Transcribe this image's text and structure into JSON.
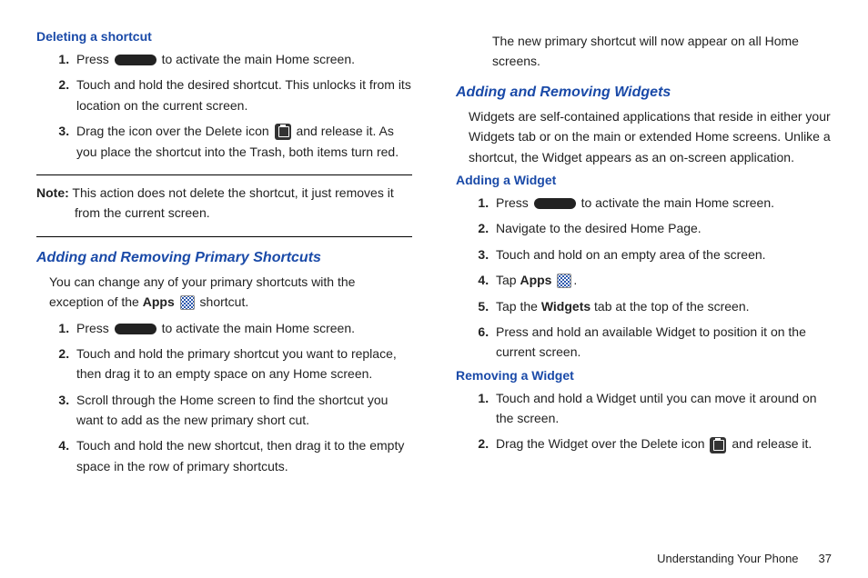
{
  "left": {
    "h1": "Deleting a shortcut",
    "steps1": {
      "s1a": "Press ",
      "s1b": " to activate the main Home screen.",
      "s2": "Touch and hold the desired shortcut. This unlocks it from its location on the current screen.",
      "s3a": "Drag the icon over the Delete icon ",
      "s3b": " and release it. As you place the shortcut into the Trash, both items turn red."
    },
    "noteLabel": "Note:",
    "noteText": " This action does not delete the shortcut, it just removes it from the current screen.",
    "h2": "Adding and Removing Primary Shortcuts",
    "introA": "You can change any of your primary shortcuts with the exception of the ",
    "introAppsWord": "Apps",
    "introB": " shortcut.",
    "steps2": {
      "s1a": "Press ",
      "s1b": " to activate the main Home screen.",
      "s2": "Touch and hold the primary shortcut you want to replace, then drag it to an empty space on any Home screen.",
      "s3": "Scroll through the Home screen to find the shortcut you want to add as the new primary short cut.",
      "s4": "Touch and hold the new shortcut, then drag it to the empty space in the row of primary shortcuts."
    }
  },
  "right": {
    "cont": "The new primary shortcut will now appear on all Home screens.",
    "h1": "Adding and Removing Widgets",
    "intro": "Widgets are self-contained applications that reside in either your Widgets tab or on the main or extended Home screens. Unlike a shortcut, the Widget appears as an on-screen application.",
    "h2": "Adding a Widget",
    "stepsAdd": {
      "s1a": "Press ",
      "s1b": " to activate the main Home screen.",
      "s2": "Navigate to the desired Home Page.",
      "s3": "Touch and hold on an empty area of the screen.",
      "s4a": "Tap ",
      "s4apps": "Apps",
      "s4b": ".",
      "s5a": "Tap the ",
      "s5w": "Widgets",
      "s5b": " tab at the top of the screen.",
      "s6": "Press and hold an available Widget to position it on the current screen."
    },
    "h3": "Removing a Widget",
    "stepsRem": {
      "s1": "Touch and hold a Widget until you can move it around on the screen.",
      "s2a": "Drag the Widget over the Delete icon ",
      "s2b": " and release it."
    }
  },
  "footer": {
    "section": "Understanding Your Phone",
    "page": "37"
  }
}
